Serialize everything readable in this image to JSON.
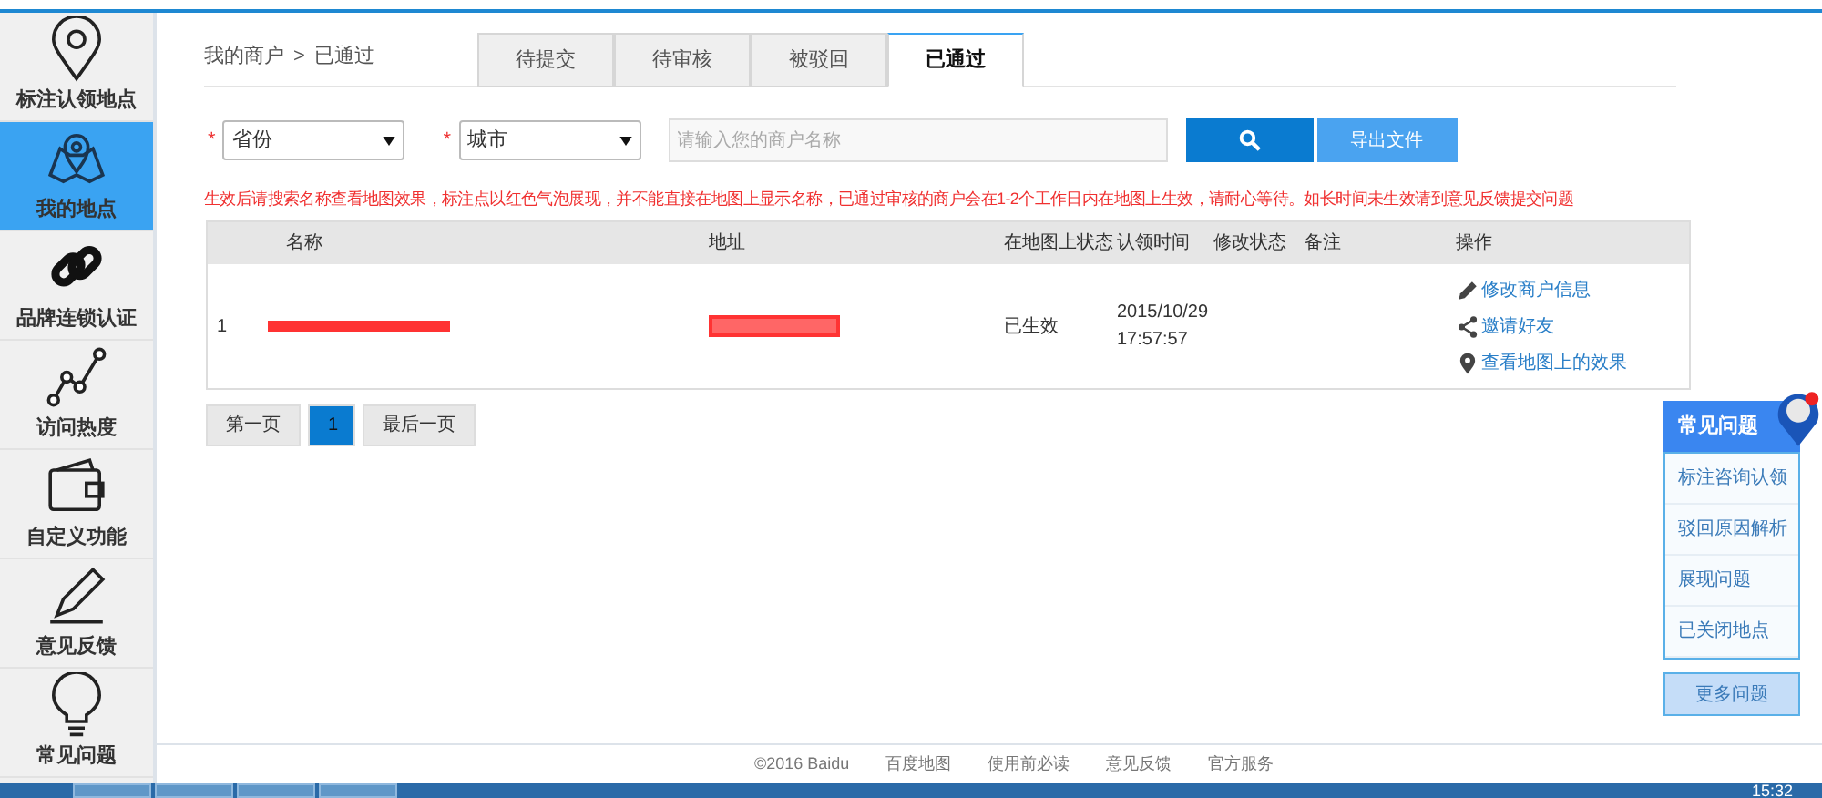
{
  "sidebar": {
    "items": [
      {
        "kind": "pin",
        "label": "标注认领地点",
        "selected": false
      },
      {
        "kind": "map",
        "label": "我的地点",
        "selected": true
      },
      {
        "kind": "link",
        "label": "品牌连锁认证",
        "selected": false
      },
      {
        "kind": "trend",
        "label": "访问热度",
        "selected": false
      },
      {
        "kind": "wallet",
        "label": "自定义功能",
        "selected": false
      },
      {
        "kind": "pencil",
        "label": "意见反馈",
        "selected": false
      },
      {
        "kind": "bulb",
        "label": "常见问题",
        "selected": false
      }
    ]
  },
  "breadcrumb": [
    "我的商户",
    ">",
    "已通过"
  ],
  "tabs": [
    {
      "label": "待提交",
      "selected": false
    },
    {
      "label": "待审核",
      "selected": false
    },
    {
      "label": "被驳回",
      "selected": false
    },
    {
      "label": "已通过",
      "selected": true
    }
  ],
  "filters": {
    "province": {
      "required": "*",
      "value": "省份"
    },
    "city": {
      "required": "*",
      "value": "城市"
    },
    "search": {
      "placeholder": "请输入您的商户名称"
    },
    "export": "导出文件"
  },
  "notice": "生效后请搜索名称查看地图效果，标注点以红色气泡展现，并不能直接在地图上显示名称，已通过审核的商户会在1-2个工作日内在地图上生效，请耐心等待。如长时间未生效请到意见反馈提交问题",
  "table": {
    "columns": [
      "名称",
      "地址",
      "在地图上状态",
      "认领时间",
      "修改状态",
      "备注",
      "操作"
    ],
    "rows": [
      {
        "index": "1",
        "status": "已生效",
        "time": [
          "2015/10/29",
          "17:57:57"
        ],
        "actions": [
          {
            "kind": "edit",
            "label": "修改商户信息"
          },
          {
            "kind": "share",
            "label": "邀请好友"
          },
          {
            "kind": "pin",
            "label": "查看地图上的效果"
          }
        ]
      }
    ]
  },
  "pagination": [
    {
      "label": "第一页",
      "selected": false
    },
    {
      "label": "1",
      "selected": true
    },
    {
      "label": "最后一页",
      "selected": false
    }
  ],
  "faq": {
    "title": "常见问题",
    "items": [
      "标注咨询认领",
      "驳回原因解析",
      "展现问题",
      "已关闭地点"
    ],
    "more": "更多问题"
  },
  "footer": [
    "©2016 Baidu",
    "百度地图",
    "使用前必读",
    "意见反馈",
    "官方服务"
  ],
  "taskbar": {
    "time": "15:32"
  }
}
